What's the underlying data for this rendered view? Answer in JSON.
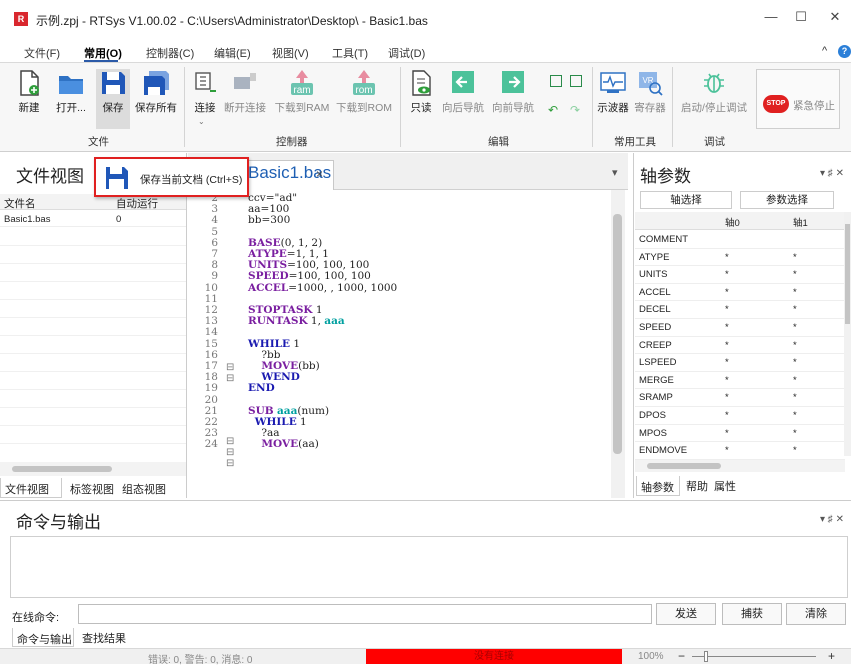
{
  "window": {
    "title": "示例.zpj - RTSys V1.00.02 - C:\\Users\\Administrator\\Desktop\\ - Basic1.bas",
    "app_icon": "R",
    "minimize": "—",
    "maximize": "☐",
    "close": "✕",
    "collapse": "^",
    "help": "?"
  },
  "menu": [
    "文件(F)",
    "常用(O)",
    "控制器(C)",
    "编辑(E)",
    "视图(V)",
    "工具(T)",
    "调试(D)"
  ],
  "ribbon": {
    "file": {
      "new": "新建",
      "open": "打开...",
      "save": "保存",
      "save_all": "保存所有",
      "group": "文件"
    },
    "controller": {
      "connect": "连接",
      "disconnect": "断开连接",
      "download_ram": "下载到RAM",
      "download_rom": "下载到ROM",
      "group": "控制器",
      "ram": "ram",
      "rom": "rom"
    },
    "edit": {
      "readonly": "只读",
      "nav_back": "向后导航",
      "nav_forward": "向前导航",
      "group": "编辑"
    },
    "tools": {
      "oscilloscope": "示波器",
      "register": "寄存器",
      "reg_badge": "VR",
      "group": "常用工具"
    },
    "debug": {
      "start_stop": "启动/停止调试",
      "estop": "紧急停止",
      "stop_badge": "STOP",
      "group": "调试"
    }
  },
  "tooltip": {
    "text": "保存当前文档 (Ctrl+S)"
  },
  "file_view": {
    "title": "文件视图",
    "columns": [
      "文件名",
      "自动运行"
    ],
    "rows": [
      {
        "name": "Basic1.bas",
        "auto": "0"
      }
    ],
    "tabs": [
      "文件视图",
      "标签视图",
      "组态视图"
    ]
  },
  "editor": {
    "tab_label": "Basic1.bas",
    "tab_close": "×",
    "dropdown": "▾",
    "lines": [
      {
        "n": "2",
        "code": "ccv=\"ad\""
      },
      {
        "n": "3",
        "code": "aa=100"
      },
      {
        "n": "4",
        "code": "bb=300"
      },
      {
        "n": "5",
        "code": ""
      },
      {
        "n": "6",
        "kw": "BASE",
        "code": "(0, 1, 2)"
      },
      {
        "n": "7",
        "kw": "ATYPE",
        "code": "=1, 1, 1"
      },
      {
        "n": "8",
        "kw": "UNITS",
        "code": "=100, 100, 100"
      },
      {
        "n": "9",
        "kw": "SPEED",
        "code": "=100, 100, 100"
      },
      {
        "n": "10",
        "kw": "ACCEL",
        "code": "=1000, , 1000, 1000"
      },
      {
        "n": "11",
        "code": ""
      },
      {
        "n": "12",
        "kw": "STOPTASK",
        "code": " 1"
      },
      {
        "n": "13",
        "kw": "RUNTASK",
        "code": " 1, ",
        "sub": "aaa"
      },
      {
        "n": "14",
        "code": ""
      },
      {
        "n": "15",
        "kwb": "WHILE",
        "code": " 1"
      },
      {
        "n": "16",
        "code": "    ?bb"
      },
      {
        "n": "17",
        "pre": "    ",
        "kw": "MOVE",
        "code": "(bb)"
      },
      {
        "n": "18",
        "pre": "    ",
        "kwb": "WEND",
        "code": ""
      },
      {
        "n": "19",
        "kwb": "END",
        "code": ""
      },
      {
        "n": "20",
        "code": ""
      },
      {
        "n": "21",
        "kw": "SUB",
        "code": " ",
        "sub": "aaa",
        "tail": "(num)"
      },
      {
        "n": "22",
        "pre": "  ",
        "kwb": "WHILE",
        "code": " 1"
      },
      {
        "n": "23",
        "code": "    ?aa"
      },
      {
        "n": "24",
        "pre": "    ",
        "kw": "MOVE",
        "code": "(aa)"
      }
    ]
  },
  "axis_params": {
    "title": "轴参数",
    "axis_select": "轴选择",
    "param_select": "参数选择",
    "cols": [
      "轴0",
      "轴1"
    ],
    "rows": [
      {
        "name": "COMMENT",
        "a0": "",
        "a1": ""
      },
      {
        "name": "ATYPE",
        "a0": "*",
        "a1": "*"
      },
      {
        "name": "UNITS",
        "a0": "*",
        "a1": "*"
      },
      {
        "name": "ACCEL",
        "a0": "*",
        "a1": "*"
      },
      {
        "name": "DECEL",
        "a0": "*",
        "a1": "*"
      },
      {
        "name": "SPEED",
        "a0": "*",
        "a1": "*"
      },
      {
        "name": "CREEP",
        "a0": "*",
        "a1": "*"
      },
      {
        "name": "LSPEED",
        "a0": "*",
        "a1": "*"
      },
      {
        "name": "MERGE",
        "a0": "*",
        "a1": "*"
      },
      {
        "name": "SRAMP",
        "a0": "*",
        "a1": "*"
      },
      {
        "name": "DPOS",
        "a0": "*",
        "a1": "*"
      },
      {
        "name": "MPOS",
        "a0": "*",
        "a1": "*"
      },
      {
        "name": "ENDMOVE",
        "a0": "*",
        "a1": "*"
      }
    ],
    "tabs": [
      "轴参数",
      "帮助",
      "属性"
    ]
  },
  "panel_controls": {
    "pin": "▾ ♯ ✕"
  },
  "command": {
    "title": "命令与输出",
    "online_label": "在线命令:",
    "send": "发送",
    "capture": "捕获",
    "clear": "清除",
    "tabs": [
      "命令与输出",
      "查找结果"
    ]
  },
  "status": {
    "messages": "错误: 0, 警告: 0, 消息: 0",
    "connection": "没有连接",
    "zoom": "100%",
    "zoom_minus": "−",
    "zoom_plus": "+"
  },
  "colors": {
    "accent": "#2b5aa8",
    "disconnected": "#ff0000",
    "highlight": "#e02020"
  }
}
